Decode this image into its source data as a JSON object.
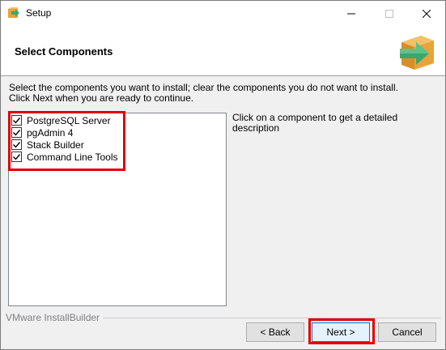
{
  "window": {
    "title": "Setup",
    "controls": {
      "minimize": "minimize-icon",
      "maximize": "maximize-icon",
      "close": "close-icon"
    }
  },
  "header": {
    "title": "Select Components",
    "icon": "installer-box-arrow-icon"
  },
  "instruction": {
    "line1": "Select the components you want to install; clear the components you do not want to install.",
    "line2": "Click Next when you are ready to continue."
  },
  "components": [
    {
      "label": "PostgreSQL Server",
      "checked": true
    },
    {
      "label": "pgAdmin 4",
      "checked": true
    },
    {
      "label": "Stack Builder",
      "checked": true
    },
    {
      "label": "Command Line Tools",
      "checked": true
    }
  ],
  "description": {
    "text": "Click on a component to get a detailed description"
  },
  "footer": {
    "brand": "VMware InstallBuilder",
    "back_label": "< Back",
    "next_label": "Next >",
    "cancel_label": "Cancel"
  },
  "colors": {
    "highlight": "#e00000",
    "accent": "#0078d7",
    "icon_green": "#3aa76d",
    "icon_box": "#e8a33a"
  }
}
